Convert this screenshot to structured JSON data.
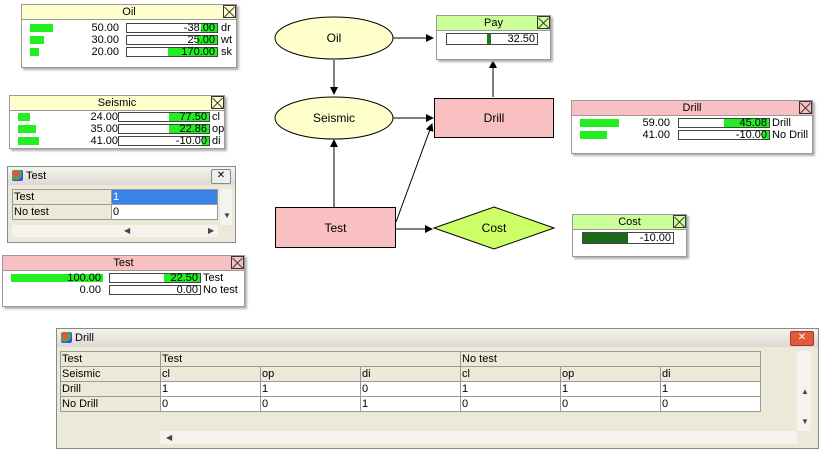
{
  "nodes": {
    "oil": "Oil",
    "seismic": "Seismic",
    "test": "Test",
    "drill": "Drill",
    "cost": "Cost",
    "pay": "Pay"
  },
  "monitors": {
    "oil": {
      "title": "Oil",
      "rows": [
        {
          "prob": "50.00",
          "prob_frac": 0.5,
          "util": "-38.00",
          "util_frac": 0.18,
          "util_color": "#22ee22",
          "label": "dr"
        },
        {
          "prob": "30.00",
          "prob_frac": 0.3,
          "util": "25.00",
          "util_frac": 0.22,
          "util_color": "#22ee22",
          "label": "wt"
        },
        {
          "prob": "20.00",
          "prob_frac": 0.2,
          "util": "170.00",
          "util_frac": 0.55,
          "util_color": "#22ee22",
          "label": "sk"
        }
      ]
    },
    "seismic": {
      "title": "Seismic",
      "rows": [
        {
          "prob": "24.00",
          "prob_frac": 0.24,
          "util": "77.50",
          "util_frac": 0.45,
          "util_color": "#22ee22",
          "label": "cl"
        },
        {
          "prob": "35.00",
          "prob_frac": 0.35,
          "util": "22.86",
          "util_frac": 0.45,
          "util_color": "#22ee22",
          "label": "op"
        },
        {
          "prob": "41.00",
          "prob_frac": 0.41,
          "util": "-10.00",
          "util_frac": 0.08,
          "util_color": "#22ee22",
          "label": "di"
        }
      ]
    },
    "drill": {
      "title": "Drill",
      "rows": [
        {
          "prob": "59.00",
          "prob_frac": 0.59,
          "util": "45.08",
          "util_frac": 0.5,
          "util_color": "#22ee22",
          "label": "Drill"
        },
        {
          "prob": "41.00",
          "prob_frac": 0.41,
          "util": "-10.00",
          "util_frac": 0.08,
          "util_color": "#22ee22",
          "label": "No Drill"
        }
      ]
    },
    "test": {
      "title": "Test",
      "rows": [
        {
          "prob": "100.00",
          "prob_frac": 1.0,
          "util": "22.50",
          "util_frac": 0.4,
          "util_color": "#22ee22",
          "label": "Test"
        },
        {
          "prob": "0.00",
          "prob_frac": 0.0,
          "util": "0.00",
          "util_frac": 0.0,
          "util_color": "#22ee22",
          "label": "No test"
        }
      ]
    },
    "pay": {
      "title": "Pay",
      "value": "32.50",
      "fill_frac": 0.05,
      "fill_color": "#1a7a1a"
    },
    "cost": {
      "title": "Cost",
      "value": "-10.00",
      "fill_frac": 0.5,
      "fill_color": "#1a6a1a"
    }
  },
  "test_window": {
    "title": "Test",
    "rows": [
      {
        "label": "Test",
        "value": "1"
      },
      {
        "label": "No test",
        "value": "0"
      }
    ]
  },
  "drill_window": {
    "title": "Drill",
    "header_rows": [
      {
        "label": "Test",
        "cells": [
          "Test",
          "No test"
        ]
      },
      {
        "label": "Seismic",
        "cells": [
          "cl",
          "op",
          "di",
          "cl",
          "op",
          "di"
        ]
      }
    ],
    "rows": [
      {
        "label": "Drill",
        "cells": [
          "1",
          "1",
          "0",
          "1",
          "1",
          "1"
        ]
      },
      {
        "label": "No Drill",
        "cells": [
          "0",
          "0",
          "1",
          "0",
          "0",
          "0"
        ]
      }
    ]
  },
  "colors": {
    "chance_node": "#ffffcc",
    "decision_node": "#f8c0c0",
    "utility_node": "#ccff66",
    "bar": "#22ee22"
  }
}
